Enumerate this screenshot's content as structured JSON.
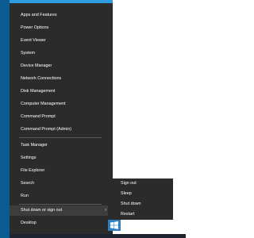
{
  "menu": {
    "group1": [
      "Apps and Features",
      "Power Options",
      "Event Viewer",
      "System",
      "Device Manager",
      "Network Connections",
      "Disk Management",
      "Computer Management",
      "Command Prompt",
      "Command Prompt (Admin)"
    ],
    "group2": [
      "Task Manager",
      "Settings",
      "File Explorer",
      "Search",
      "Run"
    ],
    "group3": [
      "Shut down or sign out",
      "Desktop"
    ]
  },
  "submenu": [
    "Sign out",
    "Sleep",
    "Shut down",
    "Restart"
  ],
  "icons": {
    "chevron": "chevron-right-icon",
    "start": "windows-logo-icon"
  },
  "colors": {
    "menu_bg": "#2b2b2b",
    "hover_bg": "#3d3d3d",
    "accent": "#2f9be0",
    "desktop": "#0a5b92"
  }
}
